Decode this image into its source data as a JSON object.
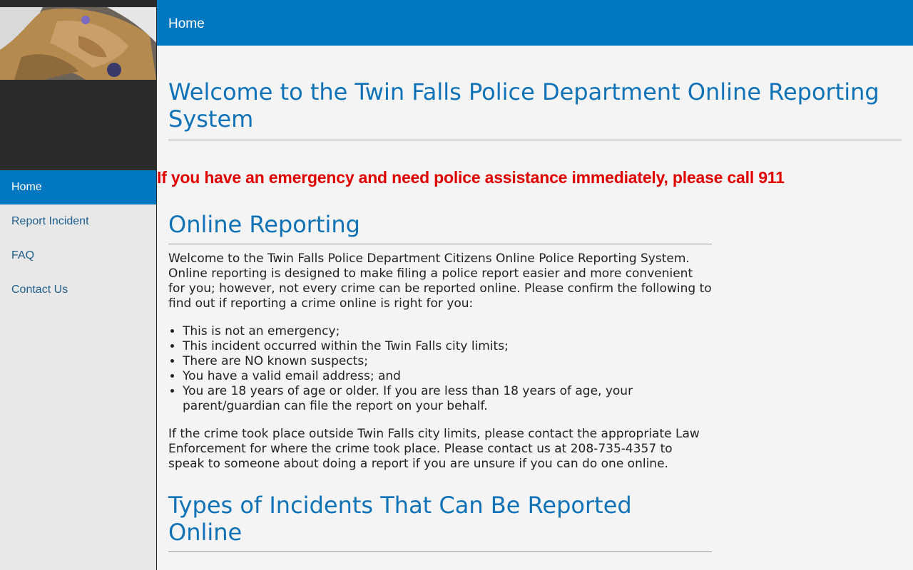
{
  "header": {
    "title": "Home"
  },
  "sidebar": {
    "items": [
      {
        "label": "Home"
      },
      {
        "label": "Report Incident"
      },
      {
        "label": "FAQ"
      },
      {
        "label": "Contact Us"
      }
    ]
  },
  "main": {
    "title": "Welcome to the Twin Falls Police Department Online Reporting System",
    "emergency": "If you have an emergency and need police assistance immediately, please call 911",
    "section1_heading": "Online Reporting",
    "intro": "Welcome to the Twin Falls Police Department Citizens Online Police Reporting System. Online reporting is designed to make filing a police report easier and more convenient for you; however, not every crime can be reported online. Please confirm the following to find out if reporting a crime online is right for you:",
    "criteria": [
      "This is not an emergency;",
      "This incident occurred within the Twin Falls city limits;",
      "There are NO known suspects;",
      "You have a valid email address; and",
      "You are 18 years of age or older. If you are less than 18 years of age, your parent/guardian can file the report on your behalf."
    ],
    "outside_note": "If the crime took place outside Twin Falls city limits, please contact the appropriate Law Enforcement for where the crime took place. Please contact us at 208-735-4357 to speak to someone about doing a report if you are unsure if you can do one online.",
    "section2_heading": "Types of Incidents That Can Be Reported Online"
  },
  "colors": {
    "accent": "#0078c1",
    "emergency": "#e00000",
    "heading": "#0f72b7"
  }
}
